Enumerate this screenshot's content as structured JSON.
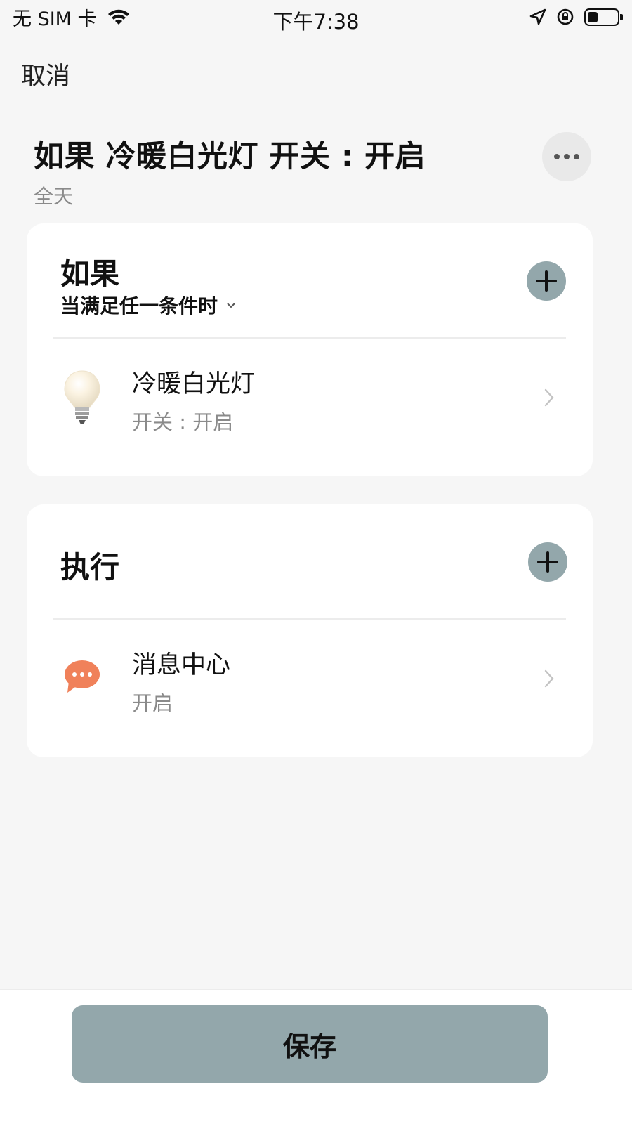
{
  "status_bar": {
    "carrier": "无 SIM 卡",
    "time": "下午7:38"
  },
  "nav": {
    "cancel_label": "取消"
  },
  "scene": {
    "title": "如果 冷暖白光灯 开关 : 开启",
    "subtitle": "全天"
  },
  "if_card": {
    "title": "如果",
    "condition_mode": "当满足任一条件时",
    "items": [
      {
        "name": "冷暖白光灯",
        "state": "开关 : 开启",
        "icon": "light-bulb-icon"
      }
    ]
  },
  "then_card": {
    "title": "执行",
    "items": [
      {
        "name": "消息中心",
        "state": "开启",
        "icon": "message-bubble-icon"
      }
    ]
  },
  "footer": {
    "save_label": "保存"
  },
  "colors": {
    "accent": "#93a7ab",
    "message_icon": "#f0815a",
    "background": "#f6f6f6"
  }
}
